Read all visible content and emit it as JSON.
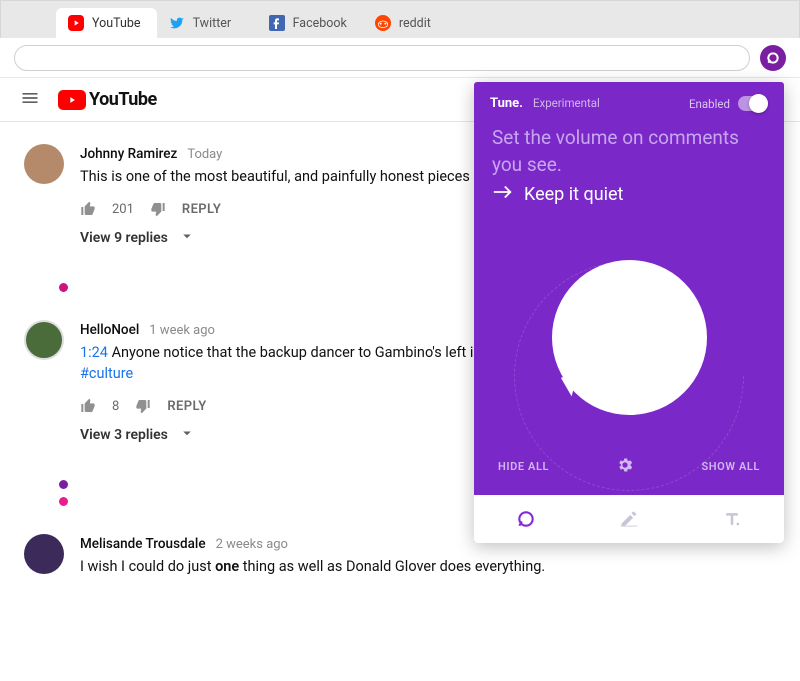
{
  "browser": {
    "tabs": [
      {
        "label": "YouTube",
        "icon": "youtube-icon",
        "active": true
      },
      {
        "label": "Twitter",
        "icon": "twitter-icon",
        "active": false
      },
      {
        "label": "Facebook",
        "icon": "facebook-icon",
        "active": false
      },
      {
        "label": "reddit",
        "icon": "reddit-icon",
        "active": false
      }
    ],
    "url_value": "",
    "extension_icon": "tune-extension-icon"
  },
  "yt_header": {
    "logo_text": "YouTube"
  },
  "comments": [
    {
      "author": "Johnny Ramirez",
      "time": "Today",
      "text_plain": "This is one of the most beautiful, and painfully honest pieces of art to ever exist.",
      "likes": "201",
      "reply_label": "REPLY",
      "replies_label": "View 9 replies"
    },
    {
      "author": "HelloNoel",
      "time": "1 week ago",
      "timestamp_link": "1:24",
      "text_before": "Anyone notice that the backup dancer to Gambino's left is doing the Orange Justice dance from fortnite ",
      "hash": "#culture",
      "likes": "8",
      "reply_label": "REPLY",
      "replies_label": "View 3 replies"
    },
    {
      "author": "Melisande Trousdale",
      "time": "2 weeks ago",
      "text_before": "I wish I could do just ",
      "emph": "one",
      "text_after": " thing as well as Donald Glover does everything."
    }
  ],
  "dots": [
    {
      "color": "#c71585"
    },
    {
      "color": "#7b1fa2"
    },
    {
      "color": "#e91e8c"
    }
  ],
  "tune": {
    "brand": "Tune.",
    "experimental": "Experimental",
    "enabled_label": "Enabled",
    "headline": "Set the volume on comments you see.",
    "sub": "Keep it quiet",
    "hide_all": "HIDE ALL",
    "show_all": "SHOW ALL",
    "colors": {
      "primary": "#7b28c9",
      "accent": "#8528d8"
    }
  }
}
